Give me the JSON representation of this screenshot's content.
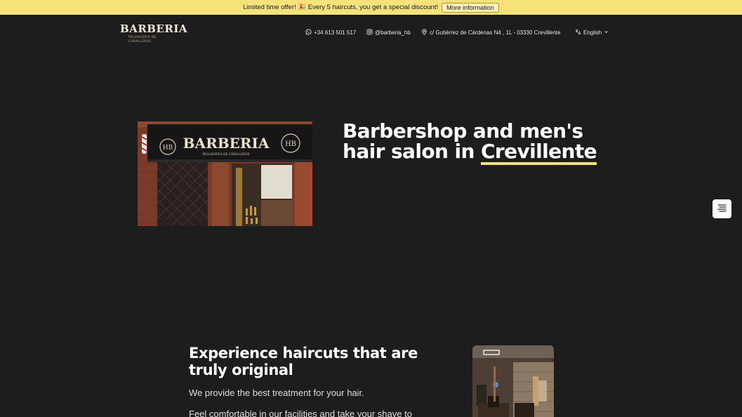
{
  "promo": {
    "text": "Limited time offer! 🎉 Every 5 haircuts, you get a special discount!",
    "button_label": "More information"
  },
  "header": {
    "logo_text": "BARBERIA",
    "logo_subtext": "PELUQUERIA DE CABALLEROS",
    "phone": "+34 613 501 517",
    "instagram": "@barberia_hb",
    "address": "c/ Gutiérrez de Cárdenas N4 , 1L - 03330 Crevillente",
    "language": "English"
  },
  "hero": {
    "title_part1": "Barbershop and men's hair salon in ",
    "title_highlight": "Crevillente",
    "image_sign_text": "BARBERIA",
    "image_sign_subtext": "PELUQUERIA DE CABALLEROS",
    "image_badge_text": "HB"
  },
  "section2": {
    "title": "Experience haircuts that are truly original",
    "paragraph1": "We provide the best treatment for your hair.",
    "paragraph2": "Feel comfortable in our facilities and take your shave to"
  },
  "colors": {
    "background": "#1e1d1d",
    "accent": "#f6e27a",
    "promo_bg": "#f6e27a",
    "text": "#ffffff"
  },
  "icons": {
    "phone": "whatsapp-icon",
    "instagram": "instagram-icon",
    "address": "location-pin-icon",
    "language": "translate-icon",
    "language_caret": "chevron-down-icon",
    "toc": "table-of-contents-icon"
  }
}
